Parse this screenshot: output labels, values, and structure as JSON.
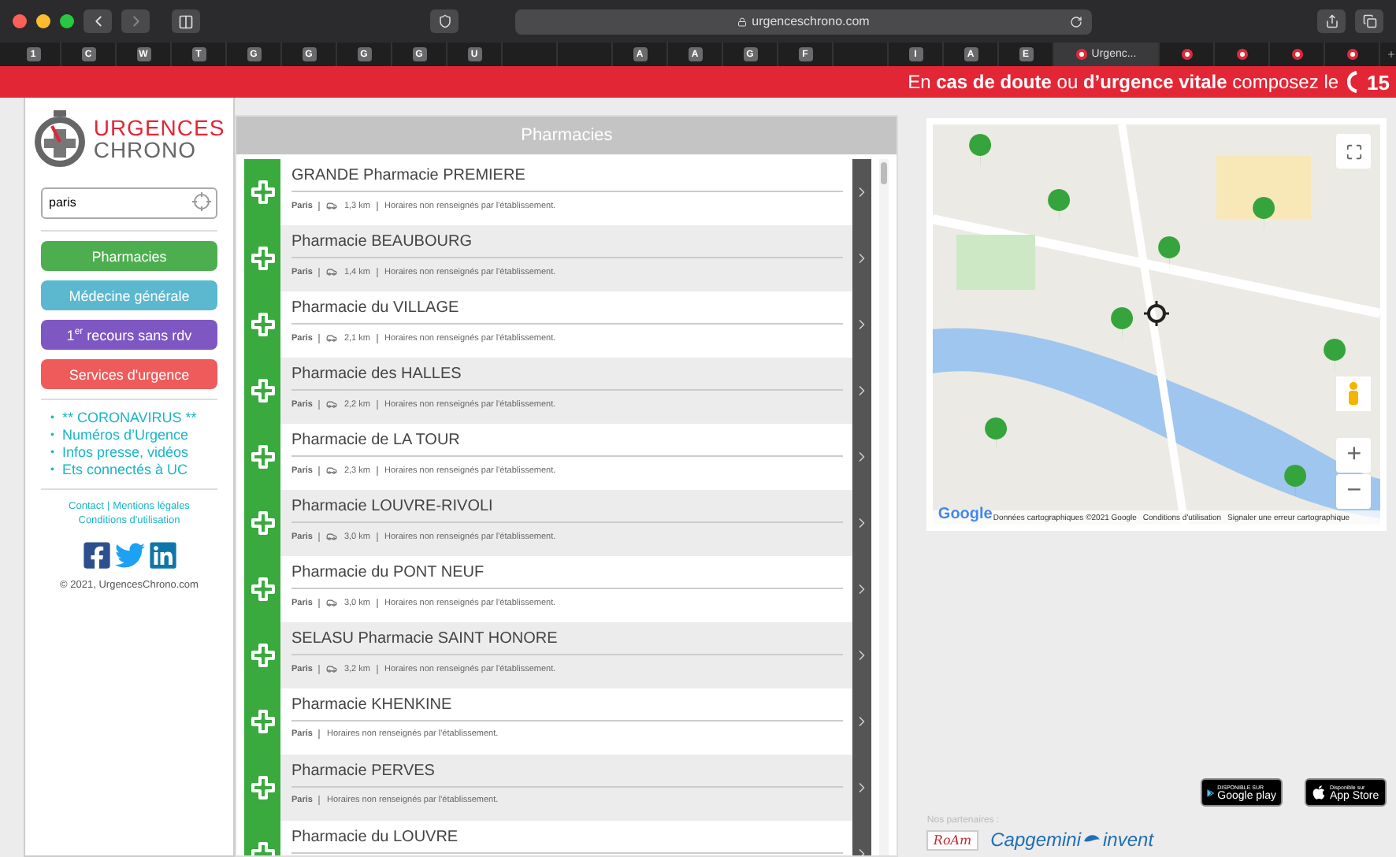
{
  "browser": {
    "url": "urgenceschrono.com",
    "tabs": [
      {
        "kind": "letter",
        "label": "1",
        "selected": false
      },
      {
        "kind": "letter",
        "label": "C",
        "selected": false
      },
      {
        "kind": "letter",
        "label": "W",
        "selected": false
      },
      {
        "kind": "letter",
        "label": "T",
        "selected": false
      },
      {
        "kind": "letter",
        "label": "G",
        "selected": false
      },
      {
        "kind": "letter",
        "label": "G",
        "selected": false
      },
      {
        "kind": "letter",
        "label": "G",
        "selected": false
      },
      {
        "kind": "letter",
        "label": "G",
        "selected": false
      },
      {
        "kind": "letter",
        "label": "U",
        "selected": false
      },
      {
        "kind": "blank",
        "selected": false
      },
      {
        "kind": "blank",
        "selected": false
      },
      {
        "kind": "letter",
        "label": "A",
        "selected": false
      },
      {
        "kind": "letter",
        "label": "A",
        "selected": false
      },
      {
        "kind": "letter",
        "label": "G",
        "selected": false
      },
      {
        "kind": "letter",
        "label": "F",
        "selected": false
      },
      {
        "kind": "blank",
        "selected": false
      },
      {
        "kind": "letter",
        "label": "I",
        "selected": false
      },
      {
        "kind": "letter",
        "label": "A",
        "selected": false
      },
      {
        "kind": "letter",
        "label": "E",
        "selected": false
      },
      {
        "kind": "page",
        "label": "Urgenc...",
        "selected": true
      },
      {
        "kind": "dot",
        "selected": false
      },
      {
        "kind": "dot",
        "selected": false
      },
      {
        "kind": "dot",
        "selected": false
      },
      {
        "kind": "dot",
        "selected": false
      }
    ]
  },
  "banner": {
    "text": "En **cas de doute** ou **d’urgence vitale** composez le",
    "number": "15"
  },
  "sidebar": {
    "logo_top": "URGENCES",
    "logo_bottom": "CHRONO",
    "search": {
      "value": "paris"
    },
    "buttons": [
      {
        "label": "Pharmacies",
        "color": "#4cae4f"
      },
      {
        "label": "Médecine générale",
        "color": "#5bb8cf"
      },
      {
        "label": "1$^{er}$ recours sans rdv",
        "color": "#7e57c2"
      },
      {
        "label": "Services d'urgence",
        "color": "#ef5b5b"
      }
    ],
    "bullet": "•",
    "links": [
      "** CORONAVIRUS **",
      "Numéros d’Urgence",
      "Infos presse, vidéos",
      "Ets connectés à UC"
    ],
    "footer_links": [
      "Contact",
      "Mentions légales"
    ],
    "footer_separator": "|",
    "footer_link2": "Conditions d'utilisation",
    "copyright": "© 2021, UrgencesChrono.com"
  },
  "list": {
    "title": "Pharmacies",
    "rows": [
      {
        "name": "GRANDE Pharmacie PREMIERE",
        "city": "Paris",
        "distance": "1,3 km",
        "hours": "Horaires non renseignés par l'établissement."
      },
      {
        "name": "Pharmacie BEAUBOURG",
        "city": "Paris",
        "distance": "1,4 km",
        "hours": "Horaires non renseignés par l'établissement."
      },
      {
        "name": "Pharmacie du VILLAGE",
        "city": "Paris",
        "distance": "2,1 km",
        "hours": "Horaires non renseignés par l'établissement."
      },
      {
        "name": "Pharmacie des HALLES",
        "city": "Paris",
        "distance": "2,2 km",
        "hours": "Horaires non renseignés par l'établissement."
      },
      {
        "name": "Pharmacie de LA TOUR",
        "city": "Paris",
        "distance": "2,3 km",
        "hours": "Horaires non renseignés par l'établissement."
      },
      {
        "name": "Pharmacie LOUVRE-RIVOLI",
        "city": "Paris",
        "distance": "3,0 km",
        "hours": "Horaires non renseignés par l'établissement."
      },
      {
        "name": "Pharmacie du PONT NEUF",
        "city": "Paris",
        "distance": "3,0 km",
        "hours": "Horaires non renseignés par l'établissement."
      },
      {
        "name": "SELASU Pharmacie SAINT HONORE",
        "city": "Paris",
        "distance": "3,2 km",
        "hours": "Horaires non renseignés par l'établissement."
      },
      {
        "name": "Pharmacie KHENKINE",
        "city": "Paris",
        "hours": "Horaires non renseignés par l'établissement."
      },
      {
        "name": "Pharmacie PERVES",
        "city": "Paris",
        "hours": "Horaires non renseignés par l'établissement."
      },
      {
        "name": "Pharmacie du LOUVRE"
      }
    ]
  },
  "map": {
    "logo": "Google",
    "attribution": "Données cartographiques ©2021 Google",
    "links": [
      "Conditions d'utilisation",
      "Signaler une erreur cartographique"
    ],
    "zoom_in": "+",
    "zoom_out": "−"
  },
  "stores": [
    {
      "kind": "google",
      "small": "DISPONIBLE SUR",
      "big": "Google play"
    },
    {
      "kind": "apple",
      "small": "Disponible sur",
      "big": "App Store"
    }
  ],
  "partners": {
    "label": "Nos partenaires :",
    "items": [
      {
        "kind": "roam",
        "text": "RoAm"
      },
      {
        "kind": "capgemini",
        "text": "Capgemini",
        "suffix": "invent"
      }
    ]
  }
}
